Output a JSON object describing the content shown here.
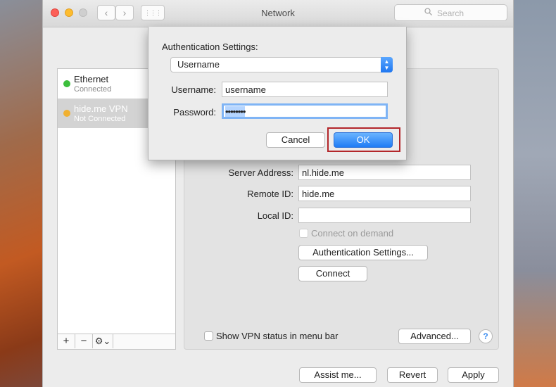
{
  "window": {
    "title": "Network"
  },
  "toolbar": {
    "search_placeholder": "Search",
    "back_icon": "‹",
    "forward_icon": "›",
    "grid_icon": "⋮⋮⋮"
  },
  "sidebar": {
    "items": [
      {
        "name": "Ethernet",
        "status": "Connected",
        "status_color": "#3cbf3c"
      },
      {
        "name": "hide.me VPN",
        "status": "Not Connected",
        "status_color": "#f0b030"
      }
    ],
    "add_label": "+",
    "remove_label": "−",
    "gear_label": "⚙⌄"
  },
  "vpn": {
    "server_address_label": "Server Address:",
    "server_address_value": "nl.hide.me",
    "remote_id_label": "Remote ID:",
    "remote_id_value": "hide.me",
    "local_id_label": "Local ID:",
    "local_id_value": "",
    "connect_on_demand_label": "Connect on demand",
    "auth_settings_button": "Authentication Settings...",
    "connect_button": "Connect",
    "show_vpn_status_label": "Show VPN status in menu bar",
    "advanced_button": "Advanced...",
    "help_label": "?"
  },
  "footer": {
    "assist_label": "Assist me...",
    "revert_label": "Revert",
    "apply_label": "Apply"
  },
  "sheet": {
    "title": "Authentication Settings:",
    "method_selected": "Username",
    "username_label": "Username:",
    "username_value": "username",
    "password_label": "Password:",
    "password_value": "••••••••",
    "cancel_label": "Cancel",
    "ok_label": "OK"
  },
  "colors": {
    "accent": "#1f7cf5",
    "highlight_border": "#b3262a"
  }
}
